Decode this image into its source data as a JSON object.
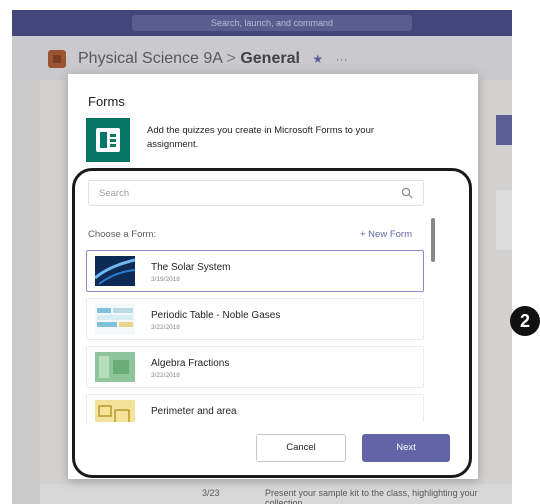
{
  "topbar": {
    "search_placeholder": "Search, launch, and command"
  },
  "header": {
    "team_name": "Physical Science 9A",
    "separator": ">",
    "channel_name": "General",
    "favorite_glyph": "★",
    "more_glyph": "···"
  },
  "background": {
    "row_date": "3/23",
    "row_text": "Present your sample kit to the class, highlighting your collection"
  },
  "dialog": {
    "title": "Forms",
    "description": "Add the quizzes you create in Microsoft Forms to your assignment.",
    "search_placeholder": "Search",
    "choose_label": "Choose a Form:",
    "new_form_label": "+ New Form",
    "forms": [
      {
        "title": "The Solar System",
        "date": "3/19/2018"
      },
      {
        "title": "Periodic Table - Noble Gases",
        "date": "3/22/2018"
      },
      {
        "title": "Algebra Fractions",
        "date": "3/22/2018"
      },
      {
        "title": "Perimeter and area",
        "date": ""
      }
    ],
    "cancel_label": "Cancel",
    "next_label": "Next"
  },
  "callout": {
    "number": "2"
  },
  "colors": {
    "accent": "#6264a7",
    "forms_brand": "#077568",
    "topbar": "#44457a"
  },
  "icons": {
    "search": "search-icon",
    "forms": "forms-logo-icon"
  }
}
